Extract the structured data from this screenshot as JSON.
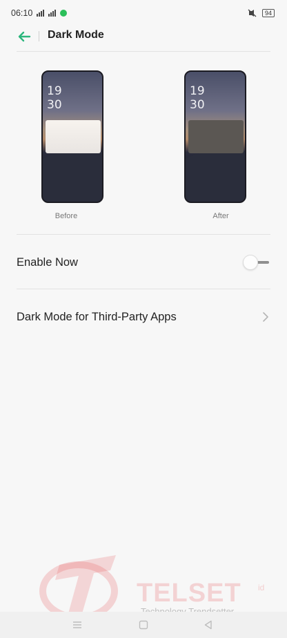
{
  "status_bar": {
    "time": "06:10",
    "battery": "94",
    "icons": [
      "signal-icon",
      "signal-icon",
      "whatsapp-icon",
      "mute-icon",
      "battery-icon"
    ]
  },
  "header": {
    "title": "Dark Mode",
    "back_icon": "back-arrow-icon",
    "accent_color": "#2cb67d"
  },
  "preview": {
    "clock_hour": "19",
    "clock_minute": "30",
    "before_label": "Before",
    "after_label": "After"
  },
  "settings": {
    "enable_now": {
      "label": "Enable Now",
      "enabled": false
    },
    "third_party": {
      "label": "Dark Mode for Third-Party Apps",
      "icon": "chevron-right-icon"
    }
  },
  "watermark": {
    "brand": "TELSET",
    "brand_suffix": "id",
    "tagline": "Technology Trendsetter"
  }
}
